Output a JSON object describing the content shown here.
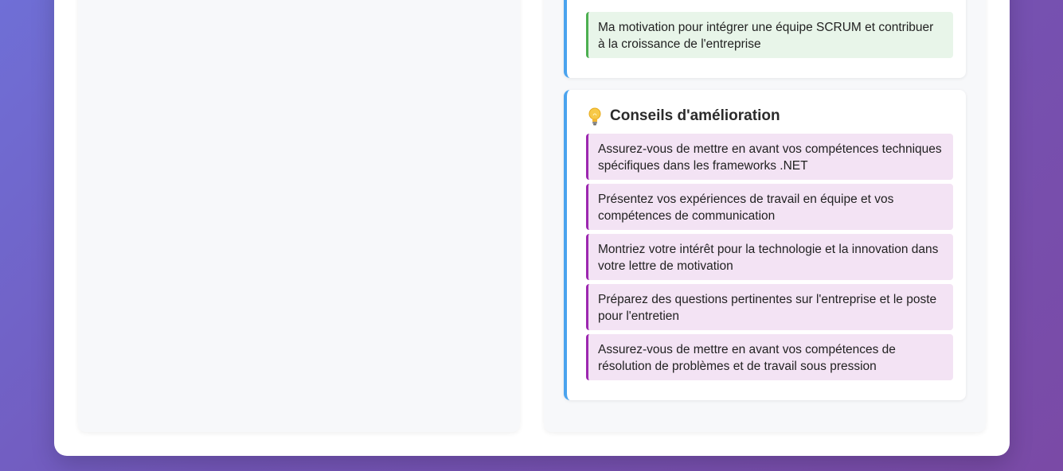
{
  "strengths_section": {
    "items": [
      "...",
      "Ma motivation pour intégrer une équipe SCRUM et contribuer à la croissance de l'entreprise"
    ]
  },
  "advice_section": {
    "icon": "lightbulb-icon",
    "title": "Conseils d'amélioration",
    "items": [
      "Assurez-vous de mettre en avant vos compétences techniques spécifiques dans les frameworks .NET",
      "Présentez vos expériences de travail en équipe et vos compétences de communication",
      "Montriez votre intérêt pour la technologie et la innovation dans votre lettre de motivation",
      "Préparez des questions pertinentes sur l'entreprise et le poste pour l'entretien",
      "Assurez-vous de mettre en avant vos compétences de résolution de problèmes et de travail sous pression"
    ]
  },
  "colors": {
    "accent_blue": "#4aa3ee",
    "strength_green": "#4caf50",
    "advice_purple": "#9c27b0"
  }
}
